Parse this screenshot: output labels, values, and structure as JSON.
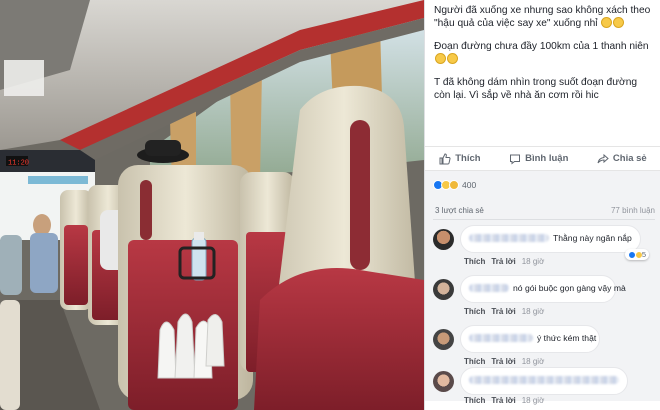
{
  "post": {
    "caption_line1": "Người đã xuống xe nhưng sao không xách theo \"hậu quả của việc say xe\" xuống nhỉ",
    "caption_line2": "Đoạn đường chưa đầy 100km của 1 thanh niên",
    "caption_line3": "T đã không dám nhìn trong suốt đoạn đường còn lại. Vì sắp về nhà ăn cơm rồi hic",
    "emojis": [
      "grinning-sweat",
      "grinning-sweat",
      "grimace",
      "grimace"
    ]
  },
  "actions": {
    "like": "Thích",
    "comment": "Bình luận",
    "share": "Chia sẻ"
  },
  "stats": {
    "reaction_count": "400",
    "reactions": [
      "like",
      "haha",
      "sad"
    ],
    "shares": "3 lượt chia sẻ",
    "comments": "77 bình luận"
  },
  "comments": [
    {
      "text": "Thằng này ngăn nắp",
      "like": "Thích",
      "reply": "Trả lời",
      "time": "18 giờ",
      "reaction_count": "5"
    },
    {
      "text": "nó gói buộc gọn gàng vậy mà",
      "like": "Thích",
      "reply": "Trả lời",
      "time": "18 giờ"
    },
    {
      "text": "ý thức kém thật",
      "like": "Thích",
      "reply": "Trả lời",
      "time": "18 giờ"
    },
    {
      "text": "",
      "like": "Thích",
      "reply": "Trả lời",
      "time": "18 giờ"
    }
  ],
  "photo": {
    "led_clock": "11:20"
  },
  "colors": {
    "fb_blue": "#1877f2",
    "seat_red": "#a8303b",
    "seat_cream": "#e6e0cc",
    "curtain": "#c9a066"
  }
}
